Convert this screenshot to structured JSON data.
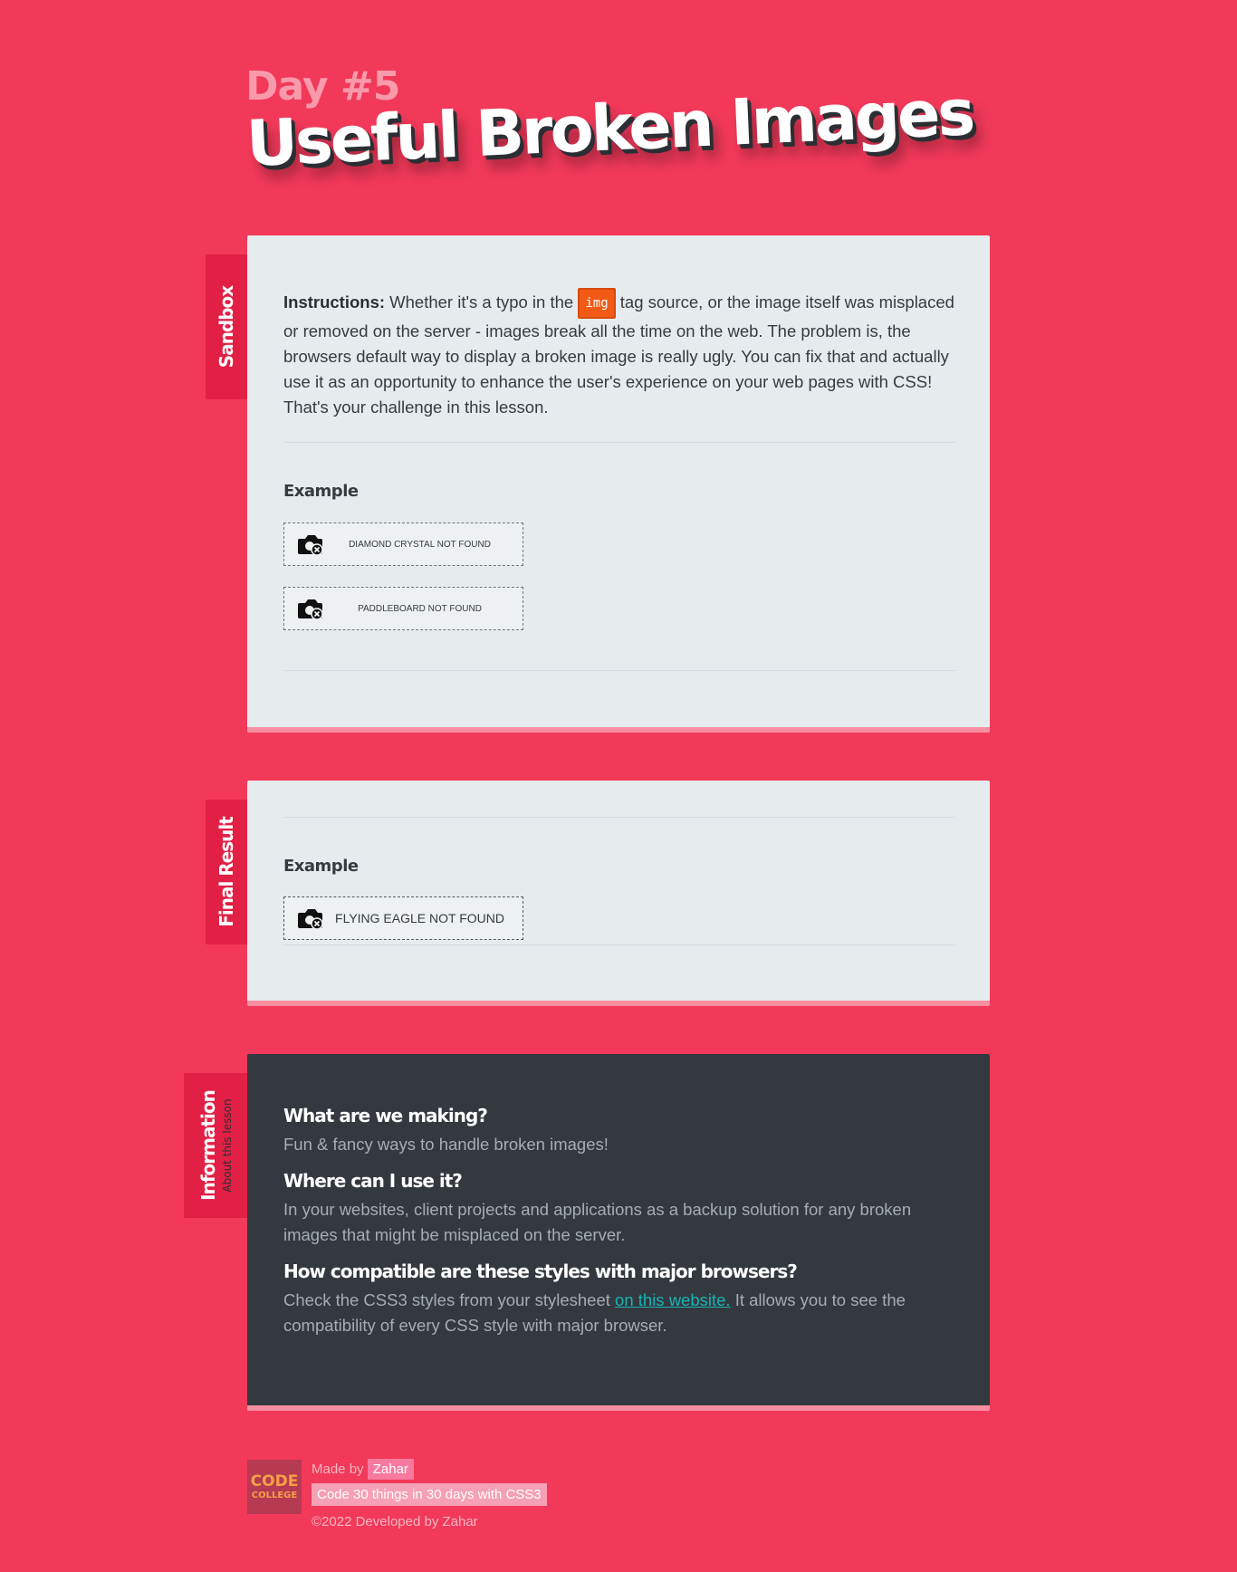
{
  "header": {
    "day": "Day #5",
    "title": "Useful Broken Images"
  },
  "sandbox": {
    "tab_label": "Sandbox",
    "instructions_label": "Instructions:",
    "instructions_pre": " Whether it's a typo in the ",
    "code_tag": "img",
    "instructions_post": " tag source, or the image itself was misplaced or removed on the server - images break all the time on the web. The problem is, the browsers default way to display a broken image is really ugly. You can fix that and actually use it as an opportunity to enhance the user's experience on your web pages with CSS! That's your challenge in this lesson.",
    "example_heading": "Example",
    "broken_images": [
      "DIAMOND CRYSTAL NOT FOUND",
      "PADDLEBOARD NOT FOUND"
    ]
  },
  "final_result": {
    "tab_label": "Final Result",
    "example_heading": "Example",
    "broken_image": "FLYING EAGLE NOT FOUND"
  },
  "information": {
    "tab_label": "Information",
    "tab_sublabel": "About this lesson",
    "q1": "What are we making?",
    "a1": "Fun & fancy ways to handle broken images!",
    "q2": "Where can I use it?",
    "a2": "In your websites, client projects and applications as a backup solution for any broken images that might be misplaced on the server.",
    "q3": "How compatible are these styles with major browsers?",
    "a3_pre": "Check the CSS3 styles from your stylesheet ",
    "a3_link": "on this website.",
    "a3_post": " It allows you to see the compatibility of every CSS style with major browser."
  },
  "footer": {
    "logo_line1": "CODE",
    "logo_line2": "COLLEGE",
    "made_by": "Made by",
    "author": "Zahar",
    "course": "Code 30 things in 30 days with CSS3",
    "copyright": "©2022 Developed by Zahar"
  },
  "colors": {
    "background": "#f2395a",
    "tab": "#e21f45",
    "panel_light": "#e6ecee",
    "panel_dark": "#33393e",
    "code_chip": "#f25a16",
    "link": "#19b3b8"
  }
}
